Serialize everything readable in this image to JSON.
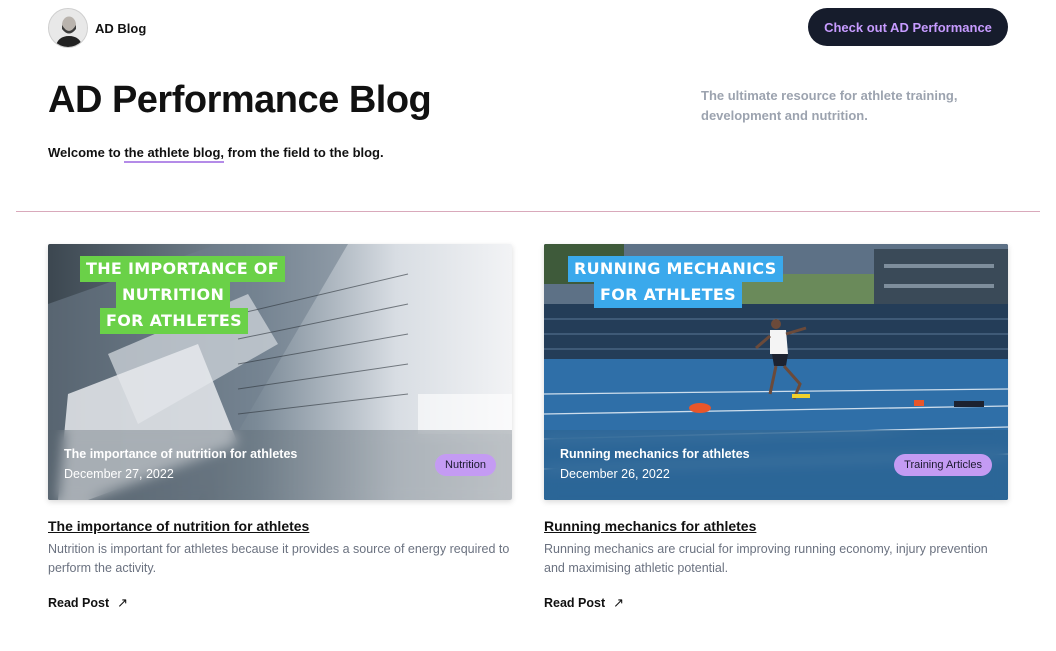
{
  "header": {
    "brand_name": "AD Blog",
    "cta_label": "Check out AD Performance"
  },
  "hero": {
    "title": "AD Performance Blog",
    "tagline": "The ultimate resource for athlete training, development and nutrition.",
    "welcome_prefix": "Welcome to ",
    "welcome_link": "the athlete blog,",
    "welcome_suffix": " from the field to the blog."
  },
  "posts": [
    {
      "image_title_lines": [
        "THE IMPORTANCE OF",
        "NUTRITION",
        "FOR ATHLETES"
      ],
      "overlay_title": "The importance of nutrition for athletes",
      "date": "December 27, 2022",
      "category": "Nutrition",
      "title": "The importance of nutrition for athletes",
      "description": "Nutrition is important for athletes because it provides a source of energy required to perform the activity.",
      "read_label": "Read Post",
      "arrow_icon": "arrow-up-right-icon"
    },
    {
      "image_title_lines": [
        "RUNNING MECHANICS",
        "FOR ATHLETES"
      ],
      "overlay_title": "Running mechanics for athletes",
      "date": "December 26, 2022",
      "category": "Training Articles",
      "title": "Running mechanics for athletes",
      "description": "Running mechanics are crucial for improving running economy, injury prevention and maximising athletic potential.",
      "read_label": "Read Post",
      "arrow_icon": "arrow-up-right-icon"
    }
  ],
  "colors": {
    "cta_bg": "#161c2c",
    "cta_text": "#c79bff",
    "badge_bg": "#c49bf3",
    "nutrition_title_bg": "#6ad148",
    "running_title_bg": "#3aa9ec",
    "divider": "#d9a9bb"
  }
}
